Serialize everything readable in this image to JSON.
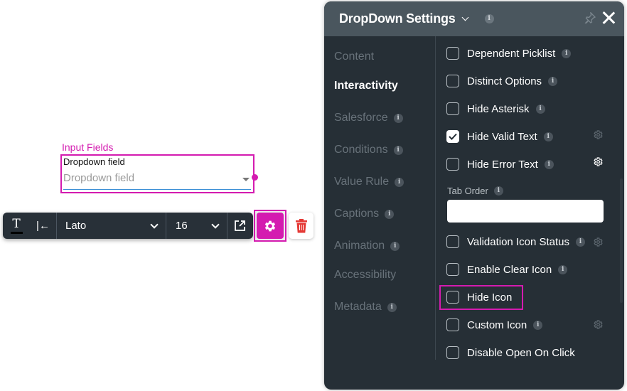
{
  "canvas": {
    "widget": {
      "title": "Input Fields",
      "field_label": "Dropdown field",
      "placeholder": "Dropdown field"
    }
  },
  "toolbar": {
    "text_style_icon": "text-underline-icon",
    "align_icon": "align-left-icon",
    "font_family": "Lato",
    "font_size": "16",
    "open_link_icon": "external-link-icon",
    "settings_icon": "gear-icon",
    "delete_icon": "trash-icon"
  },
  "colors": {
    "accent": "#d41bb0",
    "panel_bg": "#262f36",
    "panel_header_bg": "#4a565e",
    "toolbar_bg": "#283038",
    "delete_red": "#e53935",
    "underline_blue": "#3b8fd6"
  },
  "panel": {
    "title": "DropDown Settings",
    "nav": [
      {
        "label": "Content",
        "info": false,
        "active": false
      },
      {
        "label": "Interactivity",
        "info": false,
        "active": true
      },
      {
        "label": "Salesforce",
        "info": true,
        "active": false
      },
      {
        "label": "Conditions",
        "info": true,
        "active": false
      },
      {
        "label": "Value Rule",
        "info": true,
        "active": false
      },
      {
        "label": "Captions",
        "info": true,
        "active": false
      },
      {
        "label": "Animation",
        "info": true,
        "active": false
      },
      {
        "label": "Accessibility",
        "info": false,
        "active": false
      },
      {
        "label": "Metadata",
        "info": true,
        "active": false
      }
    ],
    "options": [
      {
        "label": "Dependent Picklist",
        "checked": false,
        "info": true,
        "gear": "none"
      },
      {
        "label": "Distinct Options",
        "checked": false,
        "info": true,
        "gear": "none"
      },
      {
        "label": "Hide Asterisk",
        "checked": false,
        "info": true,
        "gear": "none"
      },
      {
        "label": "Hide Valid Text",
        "checked": true,
        "info": true,
        "gear": "dim"
      },
      {
        "label": "Hide Error Text",
        "checked": false,
        "info": true,
        "gear": "bright"
      },
      {
        "label": "Validation Icon Status",
        "checked": false,
        "info": true,
        "gear": "dim"
      },
      {
        "label": "Enable Clear Icon",
        "checked": false,
        "info": true,
        "gear": "none"
      },
      {
        "label": "Hide Icon",
        "checked": false,
        "info": false,
        "gear": "none",
        "highlighted": true
      },
      {
        "label": "Custom Icon",
        "checked": false,
        "info": true,
        "gear": "dim"
      },
      {
        "label": "Disable Open On Click",
        "checked": false,
        "info": false,
        "gear": "none"
      }
    ],
    "tab_order": {
      "label": "Tab Order",
      "value": ""
    },
    "info_glyph": "i"
  }
}
